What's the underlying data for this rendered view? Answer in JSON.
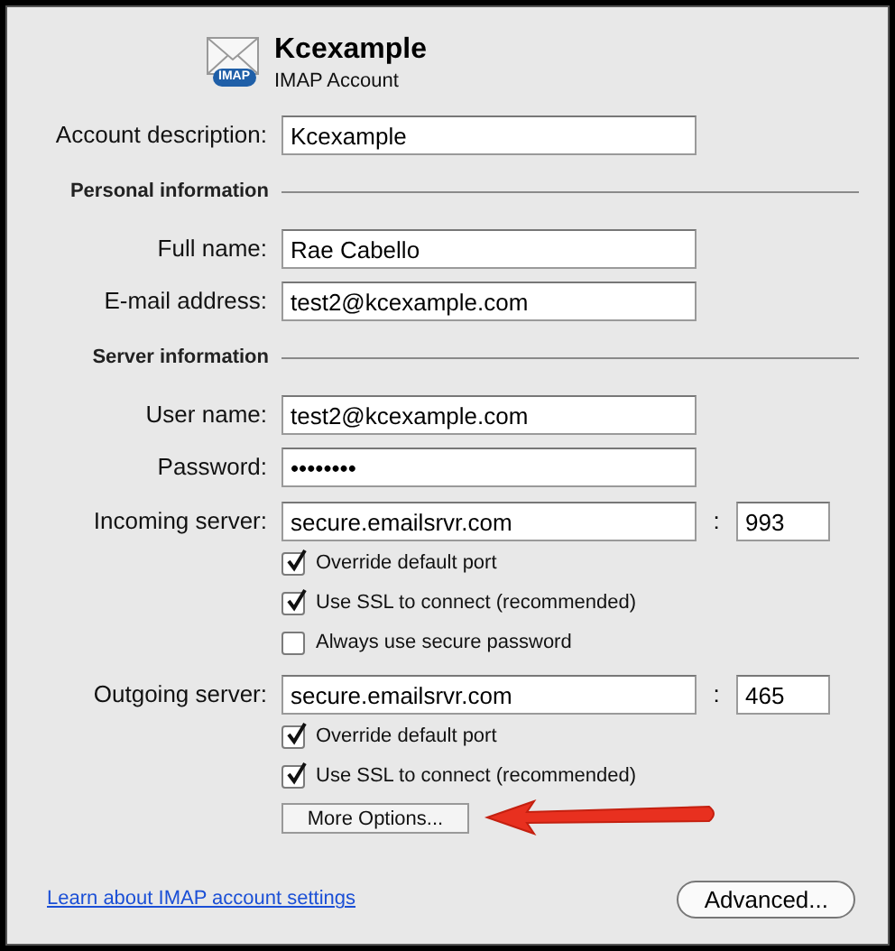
{
  "header": {
    "title": "Kcexample",
    "subtitle": "IMAP Account",
    "badge": "IMAP"
  },
  "rows": [
    {
      "kind": "field",
      "label": "Account description:",
      "value": "Kcexample"
    },
    {
      "kind": "heading",
      "label": "Personal information"
    },
    {
      "kind": "field",
      "label": "Full name:",
      "value": "Rae Cabello"
    },
    {
      "kind": "field",
      "label": "E-mail address:",
      "value": "test2@kcexample.com"
    },
    {
      "kind": "heading",
      "label": "Server information"
    },
    {
      "kind": "field",
      "label": "User name:",
      "value": "test2@kcexample.com"
    },
    {
      "kind": "field",
      "label": "Password:",
      "value": "••••••••"
    },
    {
      "kind": "server",
      "label": "Incoming server:",
      "value": "secure.emailsrvr.com",
      "separator": ":",
      "port": "993"
    },
    {
      "kind": "checkbox",
      "label": "Override default port",
      "checked": true
    },
    {
      "kind": "checkbox",
      "label": "Use SSL to connect (recommended)",
      "checked": true
    },
    {
      "kind": "checkbox",
      "label": "Always use secure password",
      "checked": false
    },
    {
      "kind": "server",
      "label": "Outgoing server:",
      "value": "secure.emailsrvr.com",
      "separator": ":",
      "port": "465"
    },
    {
      "kind": "checkbox",
      "label": "Override default port",
      "checked": true
    },
    {
      "kind": "checkbox",
      "label": "Use SSL to connect (recommended)",
      "checked": true
    },
    {
      "kind": "button",
      "label": "More Options...",
      "annotated": true
    }
  ],
  "link": "Learn about IMAP account settings",
  "advanced_button": "Advanced..."
}
